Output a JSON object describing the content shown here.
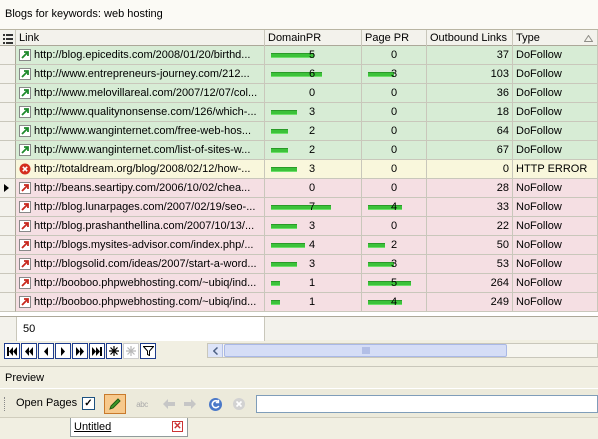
{
  "panel_title": "Blogs for keywords: web hosting",
  "columns": {
    "selector_icon": "list-icon",
    "link": "Link",
    "domain_pr": "DomainPR",
    "page_pr": "Page PR",
    "outbound": "Outbound Links",
    "type": "Type"
  },
  "sort_indicator": "sort-ascending-icon",
  "status_colors": {
    "DoFollow": "#d7ecd5",
    "HTTP ERROR": "#f9f7dc",
    "NoFollow": "#f5dfe3"
  },
  "bar_color": "#3cc23a",
  "rows": [
    {
      "link": "http://blog.epicedits.com/2008/01/20/birthd...",
      "domain_pr": "5",
      "domain_bar": 5,
      "page_pr": "0",
      "page_bar": 0,
      "outbound": "37",
      "type": "DoFollow",
      "icon": "external-link-icon",
      "current": false
    },
    {
      "link": "http://www.entrepreneurs-journey.com/212...",
      "domain_pr": "6",
      "domain_bar": 6,
      "page_pr": "3",
      "page_bar": 3,
      "outbound": "103",
      "type": "DoFollow",
      "icon": "external-link-icon",
      "current": false
    },
    {
      "link": "http://www.melovillareal.com/2007/12/07/col...",
      "domain_pr": "0",
      "domain_bar": 0,
      "page_pr": "0",
      "page_bar": 0,
      "outbound": "36",
      "type": "DoFollow",
      "icon": "external-link-icon",
      "current": false
    },
    {
      "link": "http://www.qualitynonsense.com/126/which-...",
      "domain_pr": "3",
      "domain_bar": 3,
      "page_pr": "0",
      "page_bar": 0,
      "outbound": "18",
      "type": "DoFollow",
      "icon": "external-link-icon",
      "current": false
    },
    {
      "link": "http://www.wanginternet.com/free-web-hos...",
      "domain_pr": "2",
      "domain_bar": 2,
      "page_pr": "0",
      "page_bar": 0,
      "outbound": "64",
      "type": "DoFollow",
      "icon": "external-link-icon",
      "current": false
    },
    {
      "link": "http://www.wanginternet.com/list-of-sites-w...",
      "domain_pr": "2",
      "domain_bar": 2,
      "page_pr": "0",
      "page_bar": 0,
      "outbound": "67",
      "type": "DoFollow",
      "icon": "external-link-icon",
      "current": false
    },
    {
      "link": "http://totaldream.org/blog/2008/02/12/how-...",
      "domain_pr": "3",
      "domain_bar": 3,
      "page_pr": "0",
      "page_bar": 0,
      "outbound": "0",
      "type": "HTTP ERROR",
      "icon": "error-icon",
      "current": false
    },
    {
      "link": "http://beans.seartipy.com/2006/10/02/chea...",
      "domain_pr": "0",
      "domain_bar": 0,
      "page_pr": "0",
      "page_bar": 0,
      "outbound": "28",
      "type": "NoFollow",
      "icon": "external-link-icon",
      "current": true
    },
    {
      "link": "http://blog.lunarpages.com/2007/02/19/seo-...",
      "domain_pr": "7",
      "domain_bar": 7,
      "page_pr": "4",
      "page_bar": 4,
      "outbound": "33",
      "type": "NoFollow",
      "icon": "external-link-icon",
      "current": false
    },
    {
      "link": "http://blog.prashanthellina.com/2007/10/13/...",
      "domain_pr": "3",
      "domain_bar": 3,
      "page_pr": "0",
      "page_bar": 0,
      "outbound": "22",
      "type": "NoFollow",
      "icon": "external-link-icon",
      "current": false
    },
    {
      "link": "http://blogs.mysites-advisor.com/index.php/...",
      "domain_pr": "4",
      "domain_bar": 4,
      "page_pr": "2",
      "page_bar": 2,
      "outbound": "50",
      "type": "NoFollow",
      "icon": "external-link-icon",
      "current": false
    },
    {
      "link": "http://blogsolid.com/ideas/2007/start-a-word...",
      "domain_pr": "3",
      "domain_bar": 3,
      "page_pr": "3",
      "page_bar": 3,
      "outbound": "53",
      "type": "NoFollow",
      "icon": "external-link-icon",
      "current": false
    },
    {
      "link": "http://booboo.phpwebhosting.com/~ubiq/ind...",
      "domain_pr": "1",
      "domain_bar": 1,
      "page_pr": "5",
      "page_bar": 5,
      "outbound": "264",
      "type": "NoFollow",
      "icon": "external-link-icon",
      "current": false
    },
    {
      "link": "http://booboo.phpwebhosting.com/~ubiq/ind...",
      "domain_pr": "1",
      "domain_bar": 1,
      "page_pr": "4",
      "page_bar": 4,
      "outbound": "249",
      "type": "NoFollow",
      "icon": "external-link-icon",
      "current": false
    }
  ],
  "row_count": "50",
  "nav_buttons": [
    "first-icon",
    "previous-page-icon",
    "previous-icon",
    "next-icon",
    "next-page-icon",
    "last-icon",
    "add-icon",
    "delete-icon",
    "filter-icon"
  ],
  "preview_label": "Preview",
  "toolbar": {
    "open_pages_label": "Open Pages",
    "open_pages_checked": true,
    "check_mark": "✓",
    "spellcheck_label": "abc"
  },
  "tab": {
    "label": "Untitled",
    "close_glyph": "✕"
  }
}
